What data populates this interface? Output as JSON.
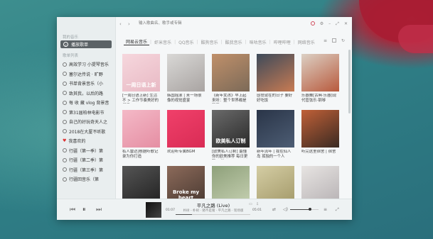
{
  "search": {
    "placeholder": "输入歌曲名、歌手或专辑"
  },
  "nav": {
    "back": "‹",
    "forward": "›"
  },
  "sidebar": {
    "section_mine": "我的音乐",
    "active_item": "播放歌单",
    "section_lists": "歌单列表",
    "items": [
      {
        "label": "高效学习 小提琴音乐",
        "heart": false
      },
      {
        "label": "塞尔达传说 · 旷野",
        "heart": false
      },
      {
        "label": "书单背景音乐（小",
        "heart": false
      },
      {
        "label": "致其我，以后的路",
        "heart": false
      },
      {
        "label": "每 收 藏 vlog 背景音",
        "heart": false
      },
      {
        "label": "第31届柏林电影节",
        "heart": false
      },
      {
        "label": "自己的好玩奇天人之",
        "heart": false
      },
      {
        "label": "2018在大厦不听歌",
        "heart": false
      },
      {
        "label": "我喜欢的",
        "heart": true
      },
      {
        "label": "行疆（第一季）第",
        "heart": false
      },
      {
        "label": "行疆（第二季）第",
        "heart": false
      },
      {
        "label": "行疆（第三季）第",
        "heart": false
      },
      {
        "label": "行疆回音乐（第",
        "heart": false
      }
    ]
  },
  "tabs": [
    "网易云音乐",
    "虾米音乐",
    "QQ音乐",
    "酷狗音乐",
    "酷我音乐",
    "咪咕音乐",
    "哔哩哔哩",
    "网络音乐"
  ],
  "active_tab": "网易云音乐",
  "cards": [
    {
      "title": "[一周日语上新] 生活不 > 工作节奏美好的相遇",
      "cover_text": "一周日语上新",
      "colors": [
        "#f6d7dd",
        "#e8b9c4"
      ]
    },
    {
      "title": "韩国摇滚 | 来一场很像的视觉盛宴",
      "cover_text": "",
      "colors": [
        "#d9d8d6",
        "#a9a4a2"
      ]
    },
    {
      "title": "《新年女孩》早上起来听：整个世界都是和平",
      "cover_text": "",
      "colors": [
        "#c0906a",
        "#7c6a58"
      ]
    },
    {
      "title": "感觉就在的日子 要好好吃饭",
      "cover_text": "",
      "colors": [
        "#3d4a5a",
        "#c87b53"
      ]
    },
    {
      "title": "乐器舞[古典·乐器]现代管弦乐·钢琴",
      "cover_text": "",
      "colors": [
        "#dcd0c4",
        "#b85a3d"
      ]
    },
    {
      "title": "私人雷达|根据听歌记录为你打造",
      "cover_text": "",
      "colors": [
        "#f4b9c7",
        "#e58ea3"
      ]
    },
    {
      "title": "欢迎听专属BGM",
      "cover_text": "",
      "colors": [
        "#f0406a",
        "#d92c55"
      ]
    },
    {
      "title": "[欧美私人订制] 最懂你的欧美推荐 每日更新35首",
      "cover_text": "欧美私人订制",
      "colors": [
        "#6a6a6a",
        "#2a2a2a"
      ]
    },
    {
      "title": "新年流年 | 我在仙人岛 孤独的一个人",
      "cover_text": "",
      "colors": [
        "#2a3548",
        "#4d5d74"
      ]
    },
    {
      "title": "听完这里宿舍 | 宿舍",
      "cover_text": "",
      "colors": [
        "#c06037",
        "#3a2a22"
      ]
    },
    {
      "title": "",
      "cover_text": "",
      "colors": [
        "#555555",
        "#222222"
      ]
    },
    {
      "title": "",
      "cover_text": "Broke my heart",
      "colors": [
        "#8c6a5a",
        "#4a3a32"
      ]
    },
    {
      "title": "",
      "cover_text": "",
      "colors": [
        "#8ea07a",
        "#c4cfb0"
      ]
    },
    {
      "title": "",
      "cover_text": "",
      "colors": [
        "#d4cda4",
        "#a49a6a"
      ]
    },
    {
      "title": "",
      "cover_text": "",
      "colors": [
        "#e7e4e2",
        "#b7b2b4"
      ]
    }
  ],
  "player": {
    "title": "平凡之路 (Live)",
    "artist": "朴树 - 朴树 · 猪不是猪  ·  平凡之路 · 现场版",
    "elapsed": "01:07",
    "duration": "05:01",
    "progress_fraction": 0.22,
    "volume_fraction": 0.7
  }
}
